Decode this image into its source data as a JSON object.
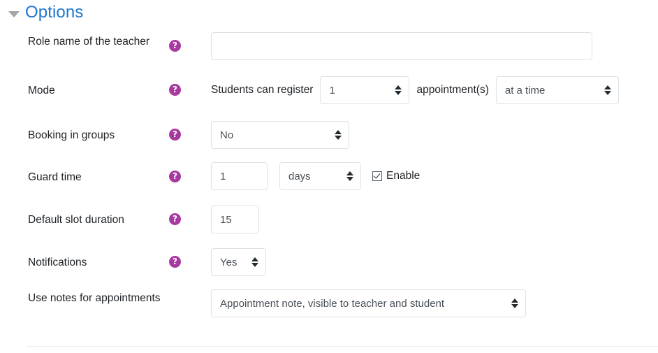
{
  "section": {
    "title": "Options",
    "collapse_icon": "chevron-down-icon",
    "expanded": true,
    "title_color": "#1d76d1"
  },
  "help_icon": {
    "glyph": "?",
    "name": "help-icon",
    "color": "#a8399f"
  },
  "fields": {
    "role_name": {
      "label": "Role name of the teacher",
      "value": "",
      "placeholder": ""
    },
    "mode": {
      "label": "Mode",
      "prefix_text": "Students can register",
      "count_value": "1",
      "middle_text": "appointment(s)",
      "scope_value": "at a time"
    },
    "booking_in_groups": {
      "label": "Booking in groups",
      "value": "No"
    },
    "guard_time": {
      "label": "Guard time",
      "amount": "1",
      "unit": "days",
      "enable_label": "Enable",
      "enable_checked": true
    },
    "default_slot_duration": {
      "label": "Default slot duration",
      "value": "15"
    },
    "notifications": {
      "label": "Notifications",
      "value": "Yes"
    },
    "use_notes": {
      "label": "Use notes for appointments",
      "value": "Appointment note, visible to teacher and student"
    }
  }
}
